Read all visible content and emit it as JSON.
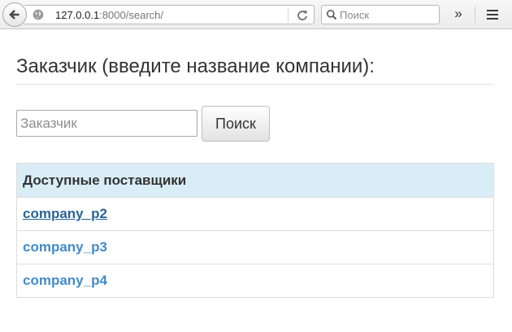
{
  "browser": {
    "url_host": "127.0.0.1",
    "url_rest": ":8000/search/",
    "search_placeholder": "Поиск",
    "overflow_label": "»"
  },
  "page": {
    "title": "Заказчик (введите название компании):",
    "customer_input": {
      "placeholder": "Заказчик",
      "value": ""
    },
    "search_button": "Поиск",
    "table": {
      "header": "Доступные поставщики",
      "rows": [
        "company_p2",
        "company_p3",
        "company_p4"
      ],
      "hovered_row": 0
    }
  },
  "colors": {
    "table_header_bg": "#d9edf7",
    "link": "#428bca",
    "link_hover": "#2a6496"
  }
}
